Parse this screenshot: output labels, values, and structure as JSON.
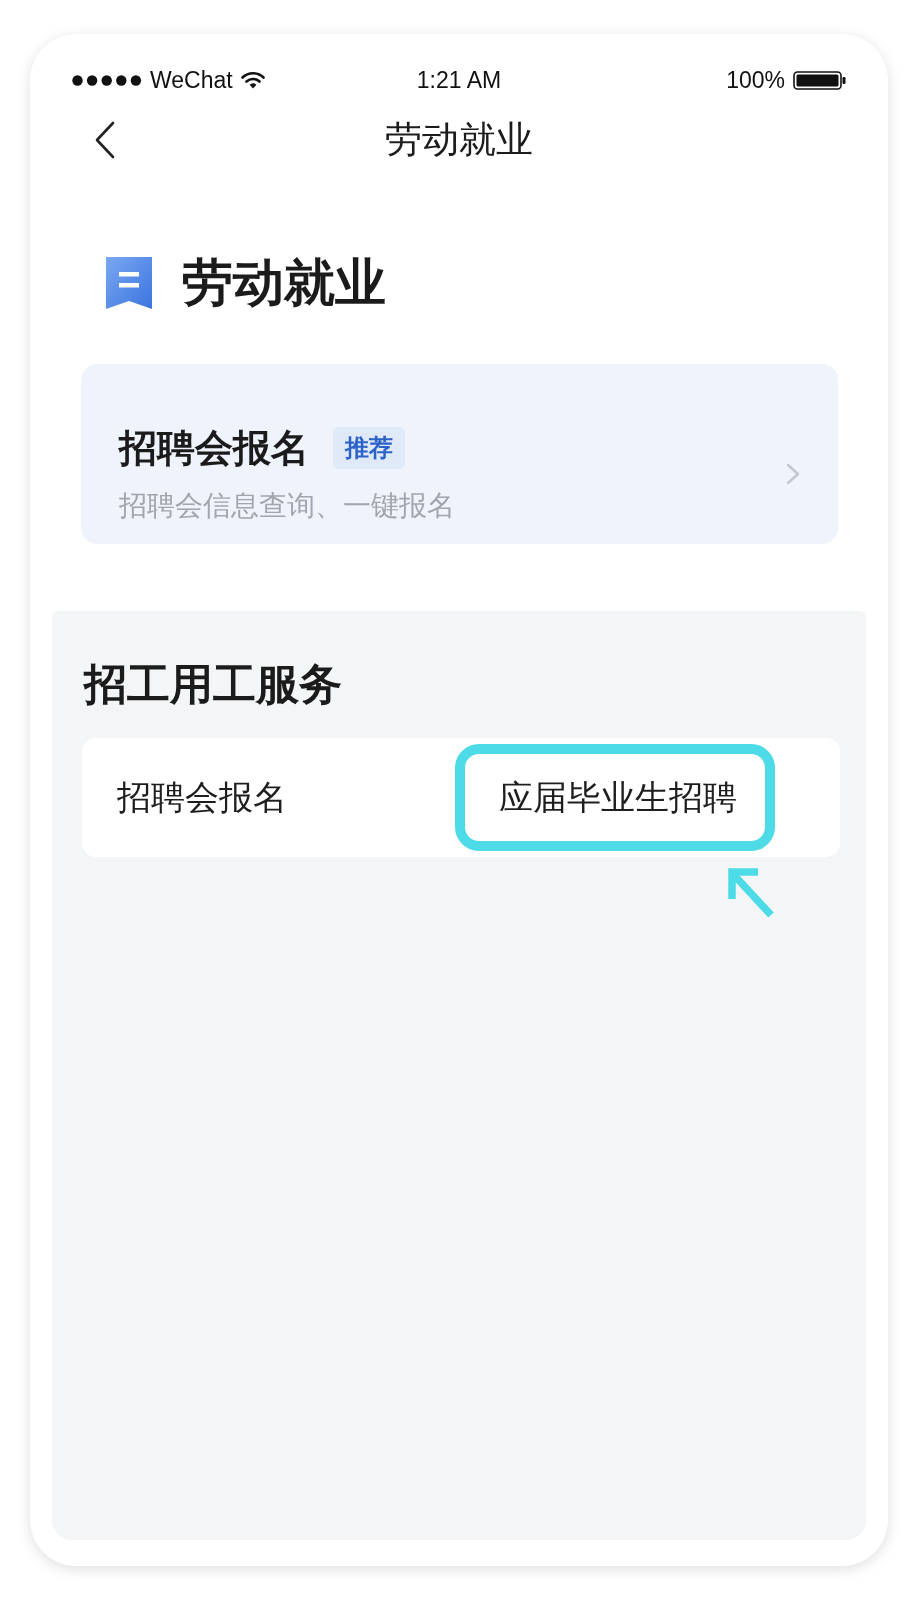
{
  "status_bar": {
    "carrier": "WeChat",
    "time": "1:21 AM",
    "battery": "100%"
  },
  "nav_bar": {
    "title": "劳动就业"
  },
  "header": {
    "title": "劳动就业"
  },
  "feature_card": {
    "title": "招聘会报名",
    "badge": "推荐",
    "subtitle": "招聘会信息查询、一键报名"
  },
  "section": {
    "title": "招工用工服务",
    "items": [
      {
        "label": "招聘会报名",
        "highlighted": false
      },
      {
        "label": "应届毕业生招聘",
        "highlighted": true
      }
    ]
  }
}
